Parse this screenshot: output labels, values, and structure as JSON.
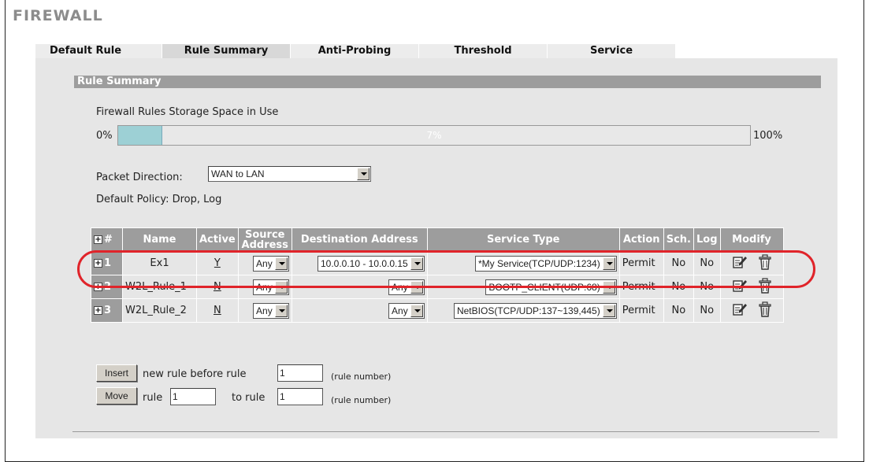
{
  "page": {
    "title": "FIREWALL"
  },
  "tabs": [
    {
      "label": "Default Rule"
    },
    {
      "label": "Rule Summary"
    },
    {
      "label": "Anti-Probing"
    },
    {
      "label": "Threshold"
    },
    {
      "label": "Service"
    }
  ],
  "section": {
    "title": "Rule Summary"
  },
  "storage": {
    "label": "Firewall Rules Storage Space in Use",
    "min_label": "0%",
    "max_label": "100%",
    "value_label": "7%",
    "value": 0.07
  },
  "packet_direction": {
    "label": "Packet Direction:",
    "value": "WAN to LAN"
  },
  "default_policy": "Default Policy: Drop, Log",
  "table": {
    "headers": {
      "num": "#",
      "name": "Name",
      "active": "Active",
      "source": "Source Address",
      "destination": "Destination Address",
      "service": "Service Type",
      "action": "Action",
      "sch": "Sch.",
      "log": "Log",
      "modify": "Modify"
    },
    "rows": [
      {
        "num": "1",
        "name": "Ex1",
        "active": "Y",
        "source": "Any",
        "destination": "10.0.0.10 - 10.0.0.15",
        "service": "*My Service(TCP/UDP:1234)",
        "action": "Permit",
        "sch": "No",
        "log": "No"
      },
      {
        "num": "2",
        "name": "W2L_Rule_1",
        "active": "N",
        "source": "Any",
        "destination": "Any",
        "service": "BOOTP_CLIENT(UDP:68)",
        "action": "Permit",
        "sch": "No",
        "log": "No"
      },
      {
        "num": "3",
        "name": "W2L_Rule_2",
        "active": "N",
        "source": "Any",
        "destination": "Any",
        "service": "NetBIOS(TCP/UDP:137~139,445)",
        "action": "Permit",
        "sch": "No",
        "log": "No"
      }
    ]
  },
  "insert_row": {
    "button": "Insert",
    "text": "new rule before rule",
    "value": "1",
    "hint": "(rule number)"
  },
  "move_row": {
    "button": "Move",
    "text1": "rule",
    "value1": "1",
    "text2": "to rule",
    "value2": "1",
    "hint": "(rule number)"
  },
  "colors": {
    "header_gray": "#9d9d9d",
    "panel_gray": "#e6e6e6",
    "progress_fill": "#9dd0d5",
    "highlight_red": "#e0242a"
  }
}
